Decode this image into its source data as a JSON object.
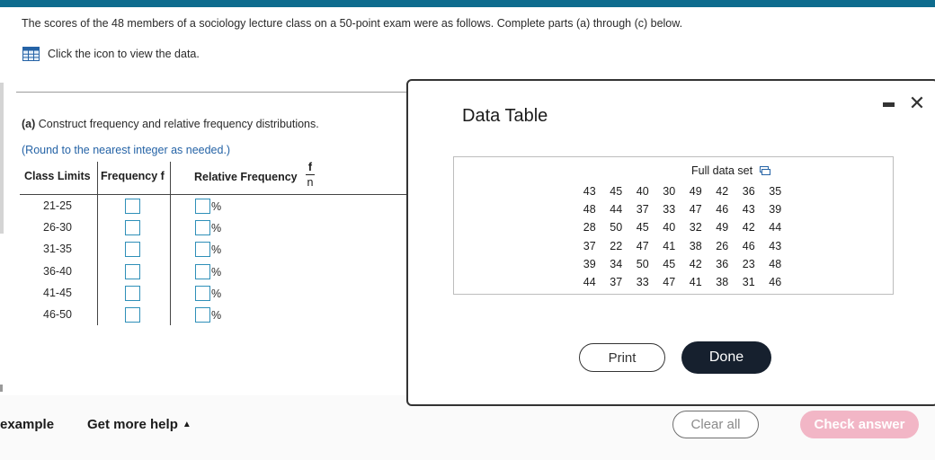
{
  "question": {
    "text": "The scores of the 48 members of a sociology lecture class on a 50-point exam were as follows. Complete parts (a) through (c) below.",
    "data_link": "Click the icon to view the data."
  },
  "part_a": {
    "label": "(a)",
    "text": "Construct frequency and relative frequency distributions.",
    "round_note": "(Round to the nearest integer as needed.)"
  },
  "table": {
    "headers": {
      "class_limits": "Class Limits",
      "frequency": "Frequency f",
      "relative": "Relative Frequency",
      "frac_num": "f",
      "frac_den": "n"
    },
    "rows": [
      {
        "label": "21-25",
        "pct": "%"
      },
      {
        "label": "26-30",
        "pct": "%"
      },
      {
        "label": "31-35",
        "pct": "%"
      },
      {
        "label": "36-40",
        "pct": "%"
      },
      {
        "label": "41-45",
        "pct": "%"
      },
      {
        "label": "46-50",
        "pct": "%"
      }
    ]
  },
  "modal": {
    "title": "Data Table",
    "full_data_label": "Full data set",
    "data": [
      [
        43,
        45,
        40,
        30,
        49,
        42,
        36,
        35
      ],
      [
        48,
        44,
        37,
        33,
        47,
        46,
        43,
        39
      ],
      [
        28,
        50,
        45,
        40,
        32,
        49,
        42,
        44
      ],
      [
        37,
        22,
        47,
        41,
        38,
        26,
        46,
        43
      ],
      [
        39,
        34,
        50,
        45,
        42,
        36,
        23,
        48
      ],
      [
        44,
        37,
        33,
        47,
        41,
        38,
        31,
        46
      ]
    ],
    "print_label": "Print",
    "done_label": "Done",
    "close_symbol": "✕"
  },
  "footer": {
    "example_label": "example",
    "help_label": "Get more help",
    "help_caret": "▲",
    "clear_label": "Clear all",
    "check_label": "Check answer"
  },
  "colors": {
    "topbar": "#0e6c8e",
    "link_blue": "#2563a6",
    "input_border": "#2e8fb8",
    "done_bg": "#16202e",
    "check_bg": "#f2b6c6"
  }
}
